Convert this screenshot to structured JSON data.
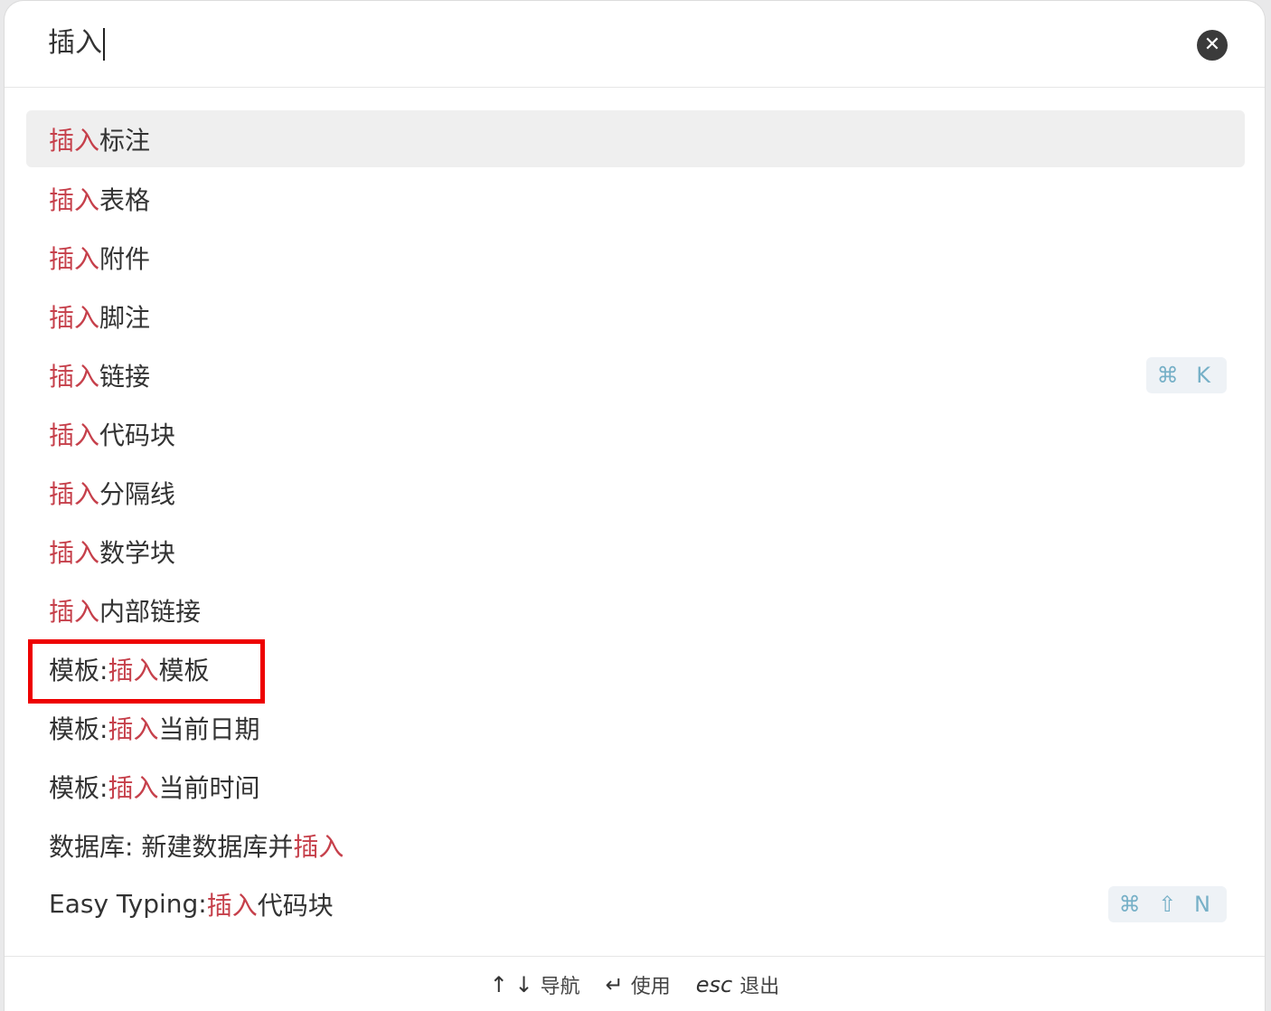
{
  "search": {
    "value": "插入"
  },
  "results": [
    {
      "prefix": "",
      "highlight": "插入",
      "suffix": "标注",
      "hotkey": ""
    },
    {
      "prefix": "",
      "highlight": "插入",
      "suffix": "表格",
      "hotkey": ""
    },
    {
      "prefix": "",
      "highlight": "插入",
      "suffix": "附件",
      "hotkey": ""
    },
    {
      "prefix": "",
      "highlight": "插入",
      "suffix": "脚注",
      "hotkey": ""
    },
    {
      "prefix": "",
      "highlight": "插入",
      "suffix": "链接",
      "hotkey": "⌘ K"
    },
    {
      "prefix": "",
      "highlight": "插入",
      "suffix": "代码块",
      "hotkey": ""
    },
    {
      "prefix": "",
      "highlight": "插入",
      "suffix": "分隔线",
      "hotkey": ""
    },
    {
      "prefix": "",
      "highlight": "插入",
      "suffix": "数学块",
      "hotkey": ""
    },
    {
      "prefix": "",
      "highlight": "插入",
      "suffix": "内部链接",
      "hotkey": ""
    },
    {
      "prefix": "模板: ",
      "highlight": "插入",
      "suffix": "模板",
      "hotkey": ""
    },
    {
      "prefix": "模板: ",
      "highlight": "插入",
      "suffix": "当前日期",
      "hotkey": ""
    },
    {
      "prefix": "模板: ",
      "highlight": "插入",
      "suffix": "当前时间",
      "hotkey": ""
    },
    {
      "prefix": "数据库: 新建数据库并",
      "highlight": "插入",
      "suffix": "",
      "hotkey": ""
    },
    {
      "prefix": "Easy Typing: ",
      "highlight": "插入",
      "suffix": "代码块",
      "hotkey": "⌘ ⇧ N"
    }
  ],
  "footer": {
    "nav_keys": "↑ ↓",
    "nav_label": "导航",
    "use_key": "↵",
    "use_label": "使用",
    "esc_key": "esc",
    "esc_label": "退出"
  },
  "colors": {
    "highlight": "#c6404b",
    "active_row": "#efefef",
    "hotkey_text": "#76b0c7",
    "annotation_box": "#ee0000"
  }
}
